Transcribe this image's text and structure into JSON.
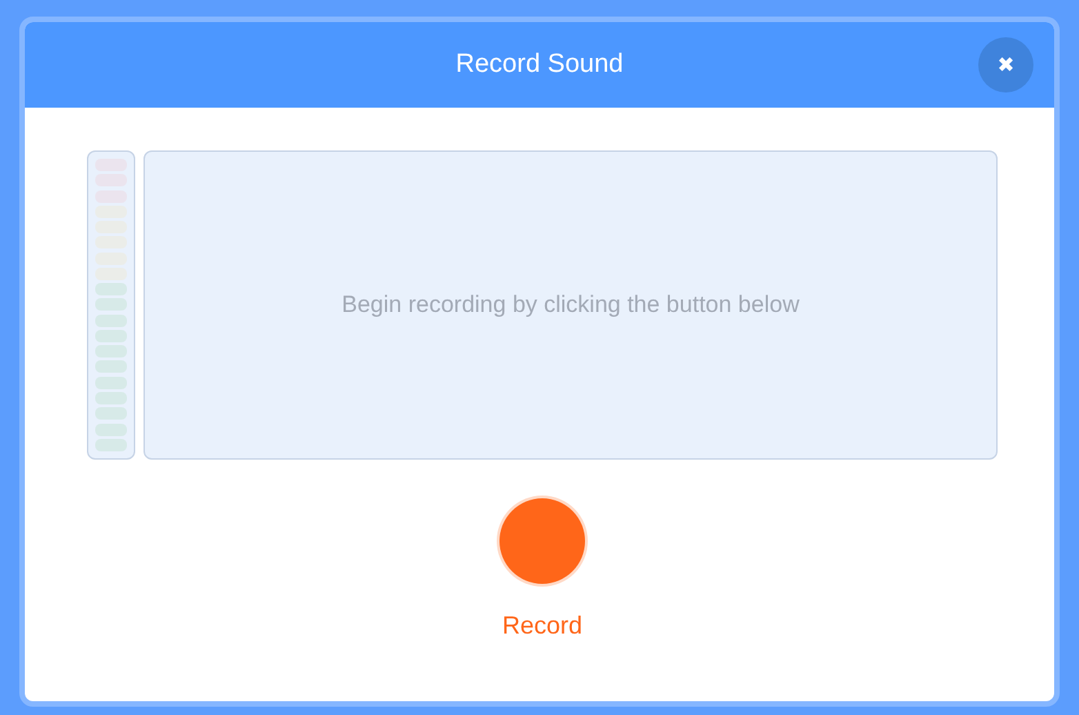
{
  "modal": {
    "title": "Record Sound",
    "close_icon": "✖"
  },
  "meter": {
    "level": 0
  },
  "waveform": {
    "hint": "Begin recording by clicking the button below"
  },
  "record_button": {
    "label": "Record"
  }
}
